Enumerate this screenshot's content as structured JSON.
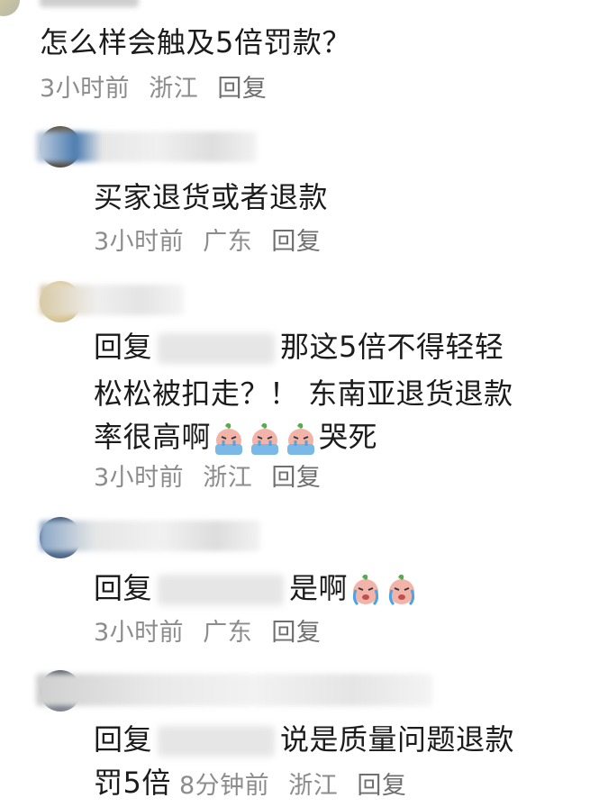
{
  "comment_main": {
    "text": "怎么样会触及5倍罚款？",
    "time": "3小时前",
    "location": "浙江",
    "reply_label": "回复"
  },
  "replies": [
    {
      "text": "买家退货或者退款",
      "time": "3小时前",
      "location": "广东",
      "reply_label": "回复"
    },
    {
      "prefix": "回复",
      "line1": "那这5倍不得轻轻",
      "line2": "松松被扣走？！ 东南亚退货退款",
      "line3_start": "率很高啊",
      "line3_end": "哭死",
      "emojis": [
        "crying-face-emoji",
        "crying-face-emoji",
        "crying-face-emoji"
      ],
      "time": "3小时前",
      "location": "浙江",
      "reply_label": "回复"
    },
    {
      "prefix": "回复",
      "text": "是啊",
      "emojis": [
        "crying-face-emoji",
        "crying-face-emoji"
      ],
      "time": "3小时前",
      "location": "广东",
      "reply_label": "回复"
    },
    {
      "prefix": "回复",
      "line1": "说是质量问题退款",
      "line2": "罚5倍",
      "time": "8分钟前",
      "location": "浙江",
      "reply_label": "回复"
    }
  ],
  "colors": {
    "text": "#1b1b1b",
    "meta": "#8c8c8c",
    "emoji_face": "#f2b3a8",
    "emoji_bowl": "#7ab8e8",
    "emoji_leaf": "#5aaa55"
  }
}
